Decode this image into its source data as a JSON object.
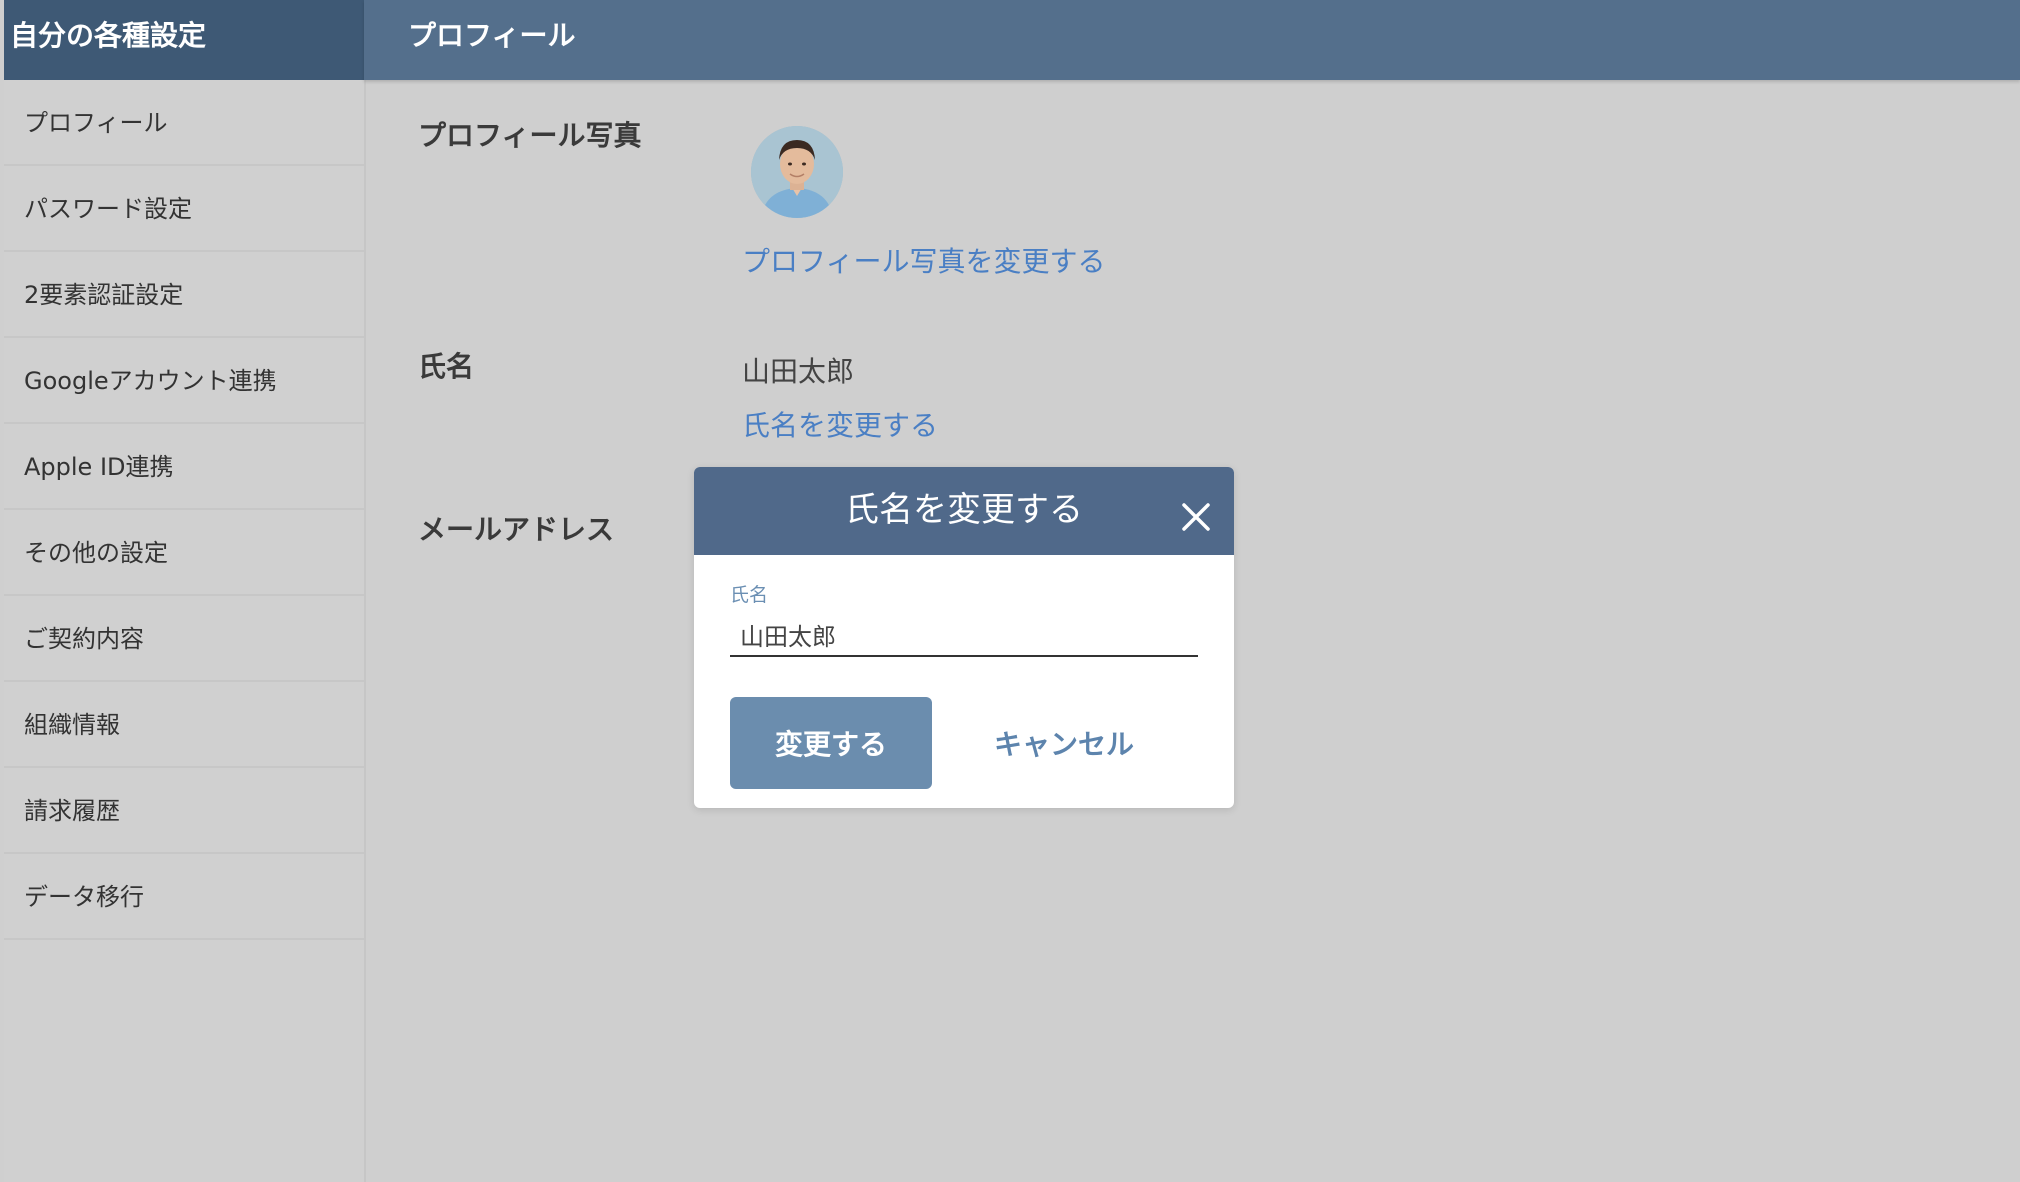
{
  "sidebar": {
    "title": "自分の各種設定",
    "items": [
      {
        "label": "プロフィール"
      },
      {
        "label": "パスワード設定"
      },
      {
        "label": "2要素認証設定"
      },
      {
        "label": "Googleアカウント連携"
      },
      {
        "label": "Apple ID連携"
      },
      {
        "label": "その他の設定"
      },
      {
        "label": "ご契約内容"
      },
      {
        "label": "組織情報"
      },
      {
        "label": "請求履歴"
      },
      {
        "label": "データ移行"
      }
    ]
  },
  "header": {
    "title": "プロフィール"
  },
  "profile": {
    "photo_label": "プロフィール写真",
    "photo_change_link": "プロフィール写真を変更する",
    "name_label": "氏名",
    "name_value": "山田太郎",
    "name_change_link": "氏名を変更する",
    "email_label": "メールアドレス"
  },
  "modal": {
    "title": "氏名を変更する",
    "field_label": "氏名",
    "field_value": "山田太郎",
    "submit_label": "変更する",
    "cancel_label": "キャンセル"
  },
  "icons": {
    "close": "close-icon",
    "avatar": "avatar"
  },
  "colors": {
    "sidebar_header": "#3e5975",
    "topbar": "#546f8c",
    "modal_header": "#50698a",
    "primary_button": "#6b8dae",
    "link": "#4a7fc4"
  }
}
